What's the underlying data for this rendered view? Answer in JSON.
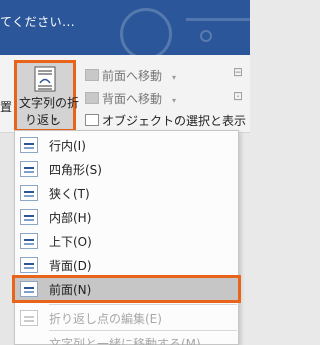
{
  "titlebar": {
    "tell_me_text": "てください..."
  },
  "ribbon": {
    "left_cut_label": "置",
    "wrap_text_button": {
      "line1": "文字列の折",
      "line2": "り返し",
      "caret": "▾"
    },
    "bring_forward": {
      "label": "前面へ移動",
      "caret": "▾"
    },
    "send_backward": {
      "label": "背面へ移動",
      "caret": "▾"
    },
    "selection_pane": {
      "label": "オブジェクトの選択と表示"
    },
    "right_edge": {
      "r1": "⊟",
      "r2": "⊡"
    }
  },
  "menu": {
    "items": [
      {
        "label": "行内(I)",
        "disabled": false
      },
      {
        "label": "四角形(S)",
        "disabled": false
      },
      {
        "label": "狭く(T)",
        "disabled": false
      },
      {
        "label": "内部(H)",
        "disabled": false
      },
      {
        "label": "上下(O)",
        "disabled": false
      },
      {
        "label": "背面(D)",
        "disabled": false
      },
      {
        "label": "前面(N)",
        "disabled": false,
        "selected": true
      },
      {
        "label": "折り返し点の編集(E)",
        "disabled": true
      },
      {
        "label": "文字列と一緒に移動する(M)",
        "disabled": true
      }
    ]
  },
  "colors": {
    "accent": "#e8641b",
    "titlebar": "#2b579a"
  }
}
